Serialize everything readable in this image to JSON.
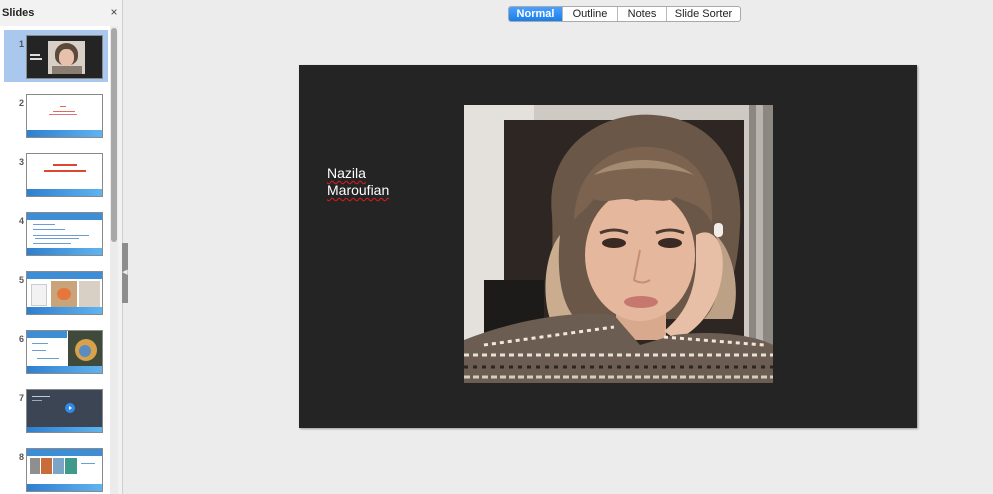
{
  "slides_pane": {
    "title": "Slides",
    "close_glyph": "×",
    "thumbnails": [
      {
        "number": "1"
      },
      {
        "number": "2"
      },
      {
        "number": "3"
      },
      {
        "number": "4"
      },
      {
        "number": "5"
      },
      {
        "number": "6"
      },
      {
        "number": "7"
      },
      {
        "number": "8"
      }
    ],
    "selected_index": 0
  },
  "view_tabs": [
    {
      "label": "Normal",
      "active": true
    },
    {
      "label": "Outline",
      "active": false
    },
    {
      "label": "Notes",
      "active": false
    },
    {
      "label": "Slide Sorter",
      "active": false
    }
  ],
  "slide": {
    "name_text": "Nazila\nMaroufian",
    "background_color": "#242424",
    "text_color": "#ffffff"
  },
  "colors": {
    "accent": "#1a7fe9",
    "selection": "#aac8ee",
    "spell_error": "#e01b1b"
  }
}
